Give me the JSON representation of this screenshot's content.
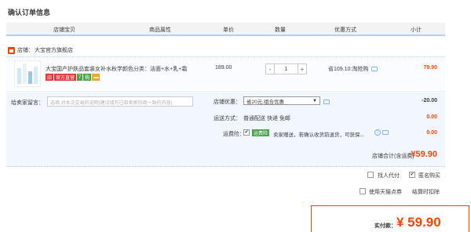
{
  "page": {
    "title": "确认订单信息"
  },
  "header": {
    "columns": [
      "店铺宝贝",
      "商品属性",
      "单价",
      "数量",
      "优惠方式",
      "小计"
    ]
  },
  "shop": {
    "label": "店铺：",
    "name": "大宝官方旗舰店"
  },
  "item": {
    "title": "大宝国产护肤品套装女补水秋学...",
    "spec": "颜色分类：洁面+水+乳+霜",
    "price": "189.00",
    "quantity": "1",
    "minus": "-",
    "plus": "+",
    "promo": "省109.10:淘抢购",
    "subtotal": "79.90",
    "badges": [
      {
        "text": "旧",
        "color": "#e4393c"
      },
      {
        "text": "官方直营",
        "color": "#e4393c"
      },
      {
        "text": "7",
        "color": "#4ca34a"
      },
      {
        "text": "购",
        "color": "#4ca34a"
      },
      {
        "text": "▬",
        "color": "#f5a623"
      }
    ]
  },
  "message": {
    "label": "给卖家留言：",
    "placeholder": "选填 对本次交易的说明(建议填写已和卖家协商一致的内容)"
  },
  "coupon": {
    "label": "店铺优惠：",
    "value": "省20元:组合优惠",
    "arrow": "▼",
    "amount": "-20.00"
  },
  "shipping": {
    "label": "运送方式：",
    "value": "普通配送 快递 免邮",
    "amount": "0.00"
  },
  "insurance": {
    "label": "运费险：",
    "check": "✔",
    "badge": "运费险",
    "text": "卖家赠送，若确认收货前退货，可获保...",
    "amount": "0.00",
    "help": "?"
  },
  "total": {
    "label": "店铺合计(含运费)",
    "amount": "¥59.90"
  },
  "options": {
    "anonymous_label": "匿名购买",
    "anonymous_check": "✔",
    "proxy_label": "找人代付",
    "tmall_points_label": "使用天猫点券",
    "settlement_label": "结算时扣除"
  },
  "payment": {
    "label": "实付款：",
    "amount": "¥ 59.90"
  },
  "colors": {
    "accent": "#ff4400",
    "header_line": "#b2d1ff",
    "panel_bg": "#f2f7ff"
  }
}
